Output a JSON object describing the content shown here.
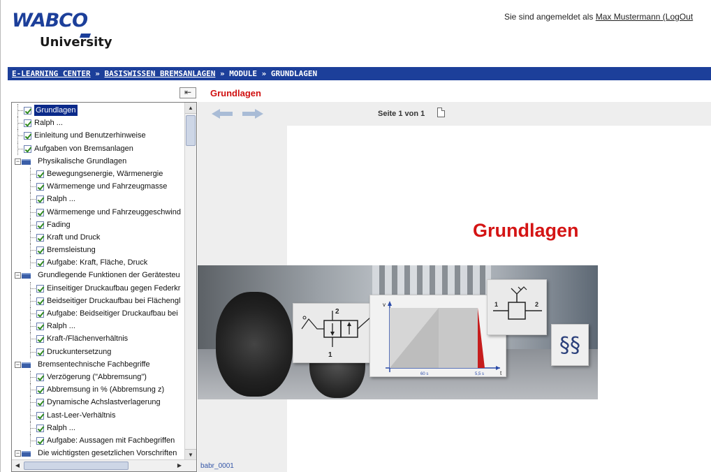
{
  "header": {
    "logo_wabco": "WABCO",
    "logo_university": "University",
    "login_prefix": "Sie sind angemeldet als ",
    "user_name": "Max Mustermann",
    "logout": " (LogOut"
  },
  "breadcrumb": {
    "items": [
      "E-LEARNING CENTER",
      "BASISWISSEN BREMSANLAGEN",
      "MODULE",
      "GRUNDLAGEN"
    ],
    "separator": " » "
  },
  "toolbar": {
    "collapse_icon": "collapse-left-icon",
    "module_title": "Grundlagen",
    "page_indicator": "Seite 1 von 1"
  },
  "tree": {
    "items": [
      {
        "label": "Grundlagen",
        "kind": "check",
        "level": 0,
        "selected": true
      },
      {
        "label": "Ralph ...",
        "kind": "check",
        "level": 0
      },
      {
        "label": "Einleitung und Benutzerhinweise",
        "kind": "check",
        "level": 0
      },
      {
        "label": "Aufgaben von Bremsanlagen",
        "kind": "check",
        "level": 0
      },
      {
        "label": "Physikalische Grundlagen",
        "kind": "folder",
        "level": 0
      },
      {
        "label": "Bewegungsenergie, Wärmenergie",
        "kind": "check",
        "level": 1
      },
      {
        "label": "Wärmemenge und Fahrzeugmasse",
        "kind": "check",
        "level": 1
      },
      {
        "label": "Ralph ...",
        "kind": "check",
        "level": 1
      },
      {
        "label": "Wärmemenge und Fahrzeuggeschwind",
        "kind": "check",
        "level": 1
      },
      {
        "label": "Fading",
        "kind": "check",
        "level": 1
      },
      {
        "label": "Kraft und Druck",
        "kind": "check",
        "level": 1
      },
      {
        "label": "Bremsleistung",
        "kind": "check",
        "level": 1
      },
      {
        "label": "Aufgabe: Kraft, Fläche, Druck",
        "kind": "check",
        "level": 1
      },
      {
        "label": "Grundlegende Funktionen der Gerätesteu",
        "kind": "folder",
        "level": 0
      },
      {
        "label": "Einseitiger Druckaufbau gegen Federkr",
        "kind": "check",
        "level": 1
      },
      {
        "label": "Beidseitiger Druckaufbau bei Flächengl",
        "kind": "check",
        "level": 1
      },
      {
        "label": "Aufgabe: Beidseitiger Druckaufbau bei",
        "kind": "check",
        "level": 1
      },
      {
        "label": "Ralph ...",
        "kind": "check",
        "level": 1
      },
      {
        "label": "Kraft-/Flächenverhältnis",
        "kind": "check",
        "level": 1
      },
      {
        "label": "Druckuntersetzung",
        "kind": "check",
        "level": 1
      },
      {
        "label": "Bremsentechnische Fachbegriffe",
        "kind": "folder",
        "level": 0
      },
      {
        "label": "Verzögerung (\"Abbremsung\")",
        "kind": "check",
        "level": 1
      },
      {
        "label": "Abbremsung in % (Abbremsung z)",
        "kind": "check",
        "level": 1
      },
      {
        "label": "Dynamische Achslastverlagerung",
        "kind": "check",
        "level": 1
      },
      {
        "label": "Last-Leer-Verhältnis",
        "kind": "check",
        "level": 1
      },
      {
        "label": "Ralph ...",
        "kind": "check",
        "level": 1
      },
      {
        "label": "Aufgabe: Aussagen mit Fachbegriffen",
        "kind": "check",
        "level": 1
      },
      {
        "label": "Die wichtigsten gesetzlichen Vorschriften",
        "kind": "folder",
        "level": 0
      }
    ]
  },
  "slide": {
    "title": "Grundlagen",
    "ref_code": "babr_0001",
    "graph_labels": {
      "v": "v",
      "t": "t",
      "t1": "60 s",
      "t2": "5,5 s"
    },
    "valve_labels": {
      "port1": "1",
      "port2": "2"
    },
    "symbol_labels": {
      "p2": "2",
      "p1": "1"
    },
    "law_symbol": "§§"
  },
  "icons": {
    "back": "arrow-left-icon",
    "forward": "arrow-right-icon",
    "page": "page-icon",
    "checkbox": "checked-checkbox-icon",
    "folder": "folder-icon"
  },
  "colors": {
    "brand_blue": "#1c3f9a",
    "title_red": "#d41414",
    "selected_bg": "#0b2a8a",
    "nav_arrow": "#a9bcd6"
  }
}
